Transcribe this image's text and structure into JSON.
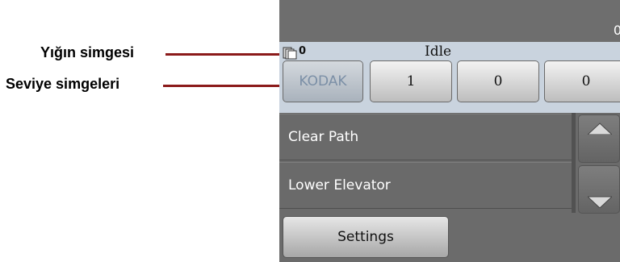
{
  "callouts": {
    "stack_label": "Yığın simgesi",
    "level_label": "Seviye simgeleri"
  },
  "topbar": {
    "counter": "0"
  },
  "status": {
    "stack_count": "0",
    "text": "Idle"
  },
  "level_buttons": [
    {
      "label": "KODAK"
    },
    {
      "label": "1"
    },
    {
      "label": "0"
    },
    {
      "label": "0"
    }
  ],
  "menu": [
    {
      "label": "Clear Path"
    },
    {
      "label": "Lower Elevator"
    }
  ],
  "settings": {
    "label": "Settings"
  },
  "colors": {
    "leader": "#8b1a1a",
    "panel": "#6b6b6b",
    "status_bar": "#c9d3de",
    "kodak_text": "#7b8fa6"
  },
  "icons": {
    "stack": "stack-icon",
    "scroll_up": "arrow-up-icon",
    "scroll_down": "arrow-down-icon"
  }
}
